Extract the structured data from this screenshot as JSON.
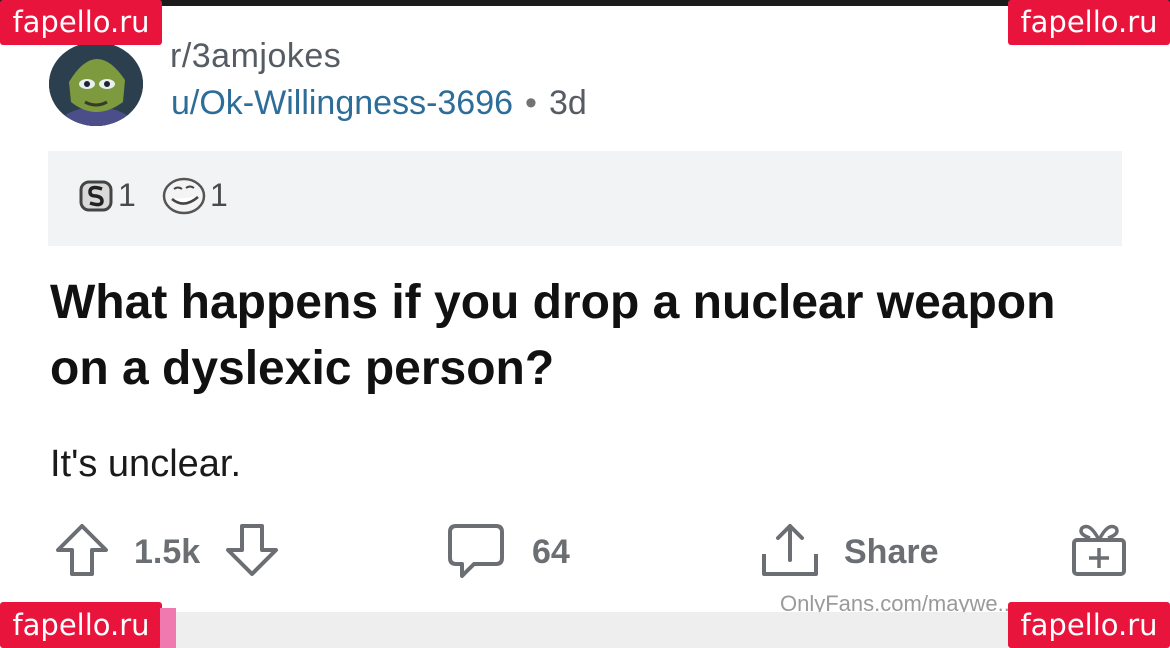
{
  "post": {
    "community": "r/3amjokes",
    "username": "u/Ok-Willingness-3696",
    "separator": "•",
    "age": "3d",
    "awards": [
      {
        "icon": "silver-award-icon",
        "count": "1"
      },
      {
        "icon": "laughing-face-award-icon",
        "count": "1"
      }
    ],
    "title": "What happens if you drop a nuclear weapon on a dyslexic person?",
    "body": "It's unclear."
  },
  "actions": {
    "upvotes": "1.5k",
    "comments": "64",
    "share": "Share"
  },
  "watermarks": {
    "site": "fapello.ru",
    "bottom_left": "fapello.ru",
    "onlyfans": "OnlyFans.com/maywe..."
  },
  "colors": {
    "watermark_bg": "#e8143c",
    "username": "#2d6d99",
    "action_gray": "#6b6e72",
    "awards_bg": "#f2f3f4"
  }
}
